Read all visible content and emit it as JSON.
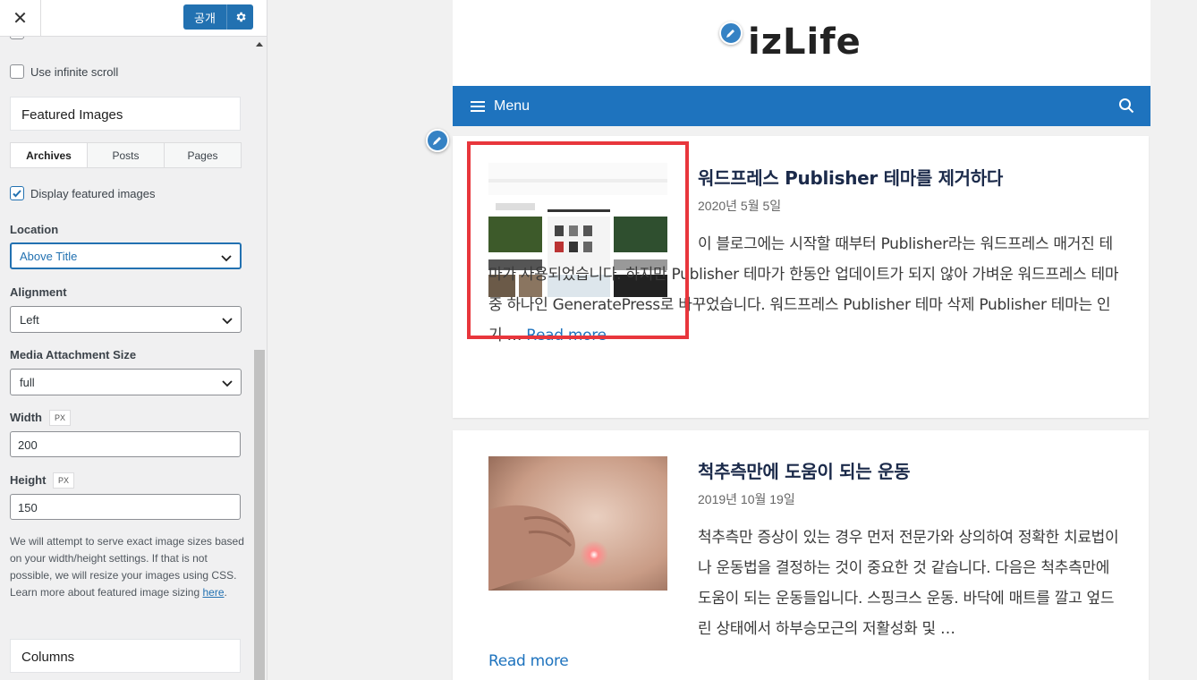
{
  "customizer": {
    "close_icon": "close-icon",
    "publish_label": "공개",
    "settings_icon": "gear-icon",
    "infinite_scroll_label": "Use infinite scroll",
    "infinite_scroll_checked": false,
    "featured_images_title": "Featured Images",
    "tabs": [
      {
        "label": "Archives",
        "active": true
      },
      {
        "label": "Posts",
        "active": false
      },
      {
        "label": "Pages",
        "active": false
      }
    ],
    "display_featured_label": "Display featured images",
    "display_featured_checked": true,
    "location_label": "Location",
    "location_value": "Above Title",
    "alignment_label": "Alignment",
    "alignment_value": "Left",
    "media_size_label": "Media Attachment Size",
    "media_size_value": "full",
    "width_label": "Width",
    "width_unit": "PX",
    "width_value": "200",
    "height_label": "Height",
    "height_unit": "PX",
    "height_value": "150",
    "description": "We will attempt to serve exact image sizes based on your width/height settings. If that is not possible, we will resize your images using CSS. Learn more about featured image sizing ",
    "description_link": "here",
    "description_end": ".",
    "columns_title": "Columns"
  },
  "site": {
    "logo_text": "izLife",
    "menu_label": "Menu",
    "posts": [
      {
        "title": "워드프레스 Publisher 테마를 제거하다",
        "date": "2020년 5월 5일",
        "excerpt": "이 블로그에는 시작할 때부터 Publisher라는 워드프레스 매거진 테마가 사용되었습니다. 하지만 Publisher 테마가 한동안 업데이트가 되지 않아 가벼운 워드프레스 테마 중 하나인 GeneratePress로 바꾸었습니다. 워드프레스 Publisher 테마 삭제 Publisher 테마는 인기 … ",
        "read_more": "Read more"
      },
      {
        "title": "척추측만에 도움이 되는 운동",
        "date": "2019년 10월 19일",
        "excerpt": "척추측만 증상이 있는 경우 먼저 전문가와 상의하여 정확한 치료법이나 운동법을 결정하는 것이 중요한 것 같습니다. 다음은 척추측만에 도움이 되는 운동들입니다. 스핑크스 운동. 바닥에 매트를 깔고 엎드린 상태에서 하부승모근의 저활성화 및 …",
        "read_more": "Read more"
      }
    ]
  },
  "colors": {
    "accent": "#2271b1",
    "nav_bg": "#1e73be",
    "highlight": "#e8363c"
  }
}
